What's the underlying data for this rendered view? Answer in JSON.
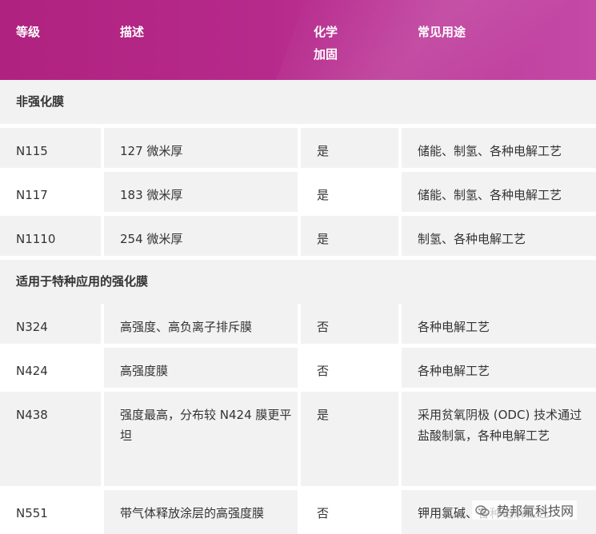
{
  "header": {
    "col_grade": "等级",
    "col_desc": "描述",
    "col_chem_line1": "化学",
    "col_chem_line2": "加固",
    "col_use": "常见用途"
  },
  "sections": {
    "non_reinforced": "非强化膜",
    "reinforced": "适用于特种应用的强化膜"
  },
  "rows": [
    {
      "grade": "N115",
      "desc": "127 微米厚",
      "chem": "是",
      "use": "储能、制氢、各种电解工艺"
    },
    {
      "grade": "N117",
      "desc": "183 微米厚",
      "chem": "是",
      "use": "储能、制氢、各种电解工艺"
    },
    {
      "grade": "N1110",
      "desc": "254 微米厚",
      "chem": "是",
      "use": "制氢、各种电解工艺"
    },
    {
      "grade": "N324",
      "desc": "高强度、高负离子排斥膜",
      "chem": "否",
      "use": "各种电解工艺"
    },
    {
      "grade": "N424",
      "desc": "高强度膜",
      "chem": "否",
      "use": "各种电解工艺"
    },
    {
      "grade": "N438",
      "desc": "强度最高，分布较 N424 膜更平坦",
      "chem": "是",
      "use": "采用贫氧阴极 (ODC) 技术通过盐酸制氯，各种电解工艺"
    },
    {
      "grade": "N551",
      "desc": "带气体释放涂层的高强度膜",
      "chem": "否",
      "use": "钾用氯碱、各种电解工艺"
    }
  ],
  "watermark": "势邦氟科技网",
  "colors": {
    "header_start": "#b0227f",
    "header_end": "#c44aa6",
    "shade": "#f2f2f2",
    "text": "#333333"
  }
}
